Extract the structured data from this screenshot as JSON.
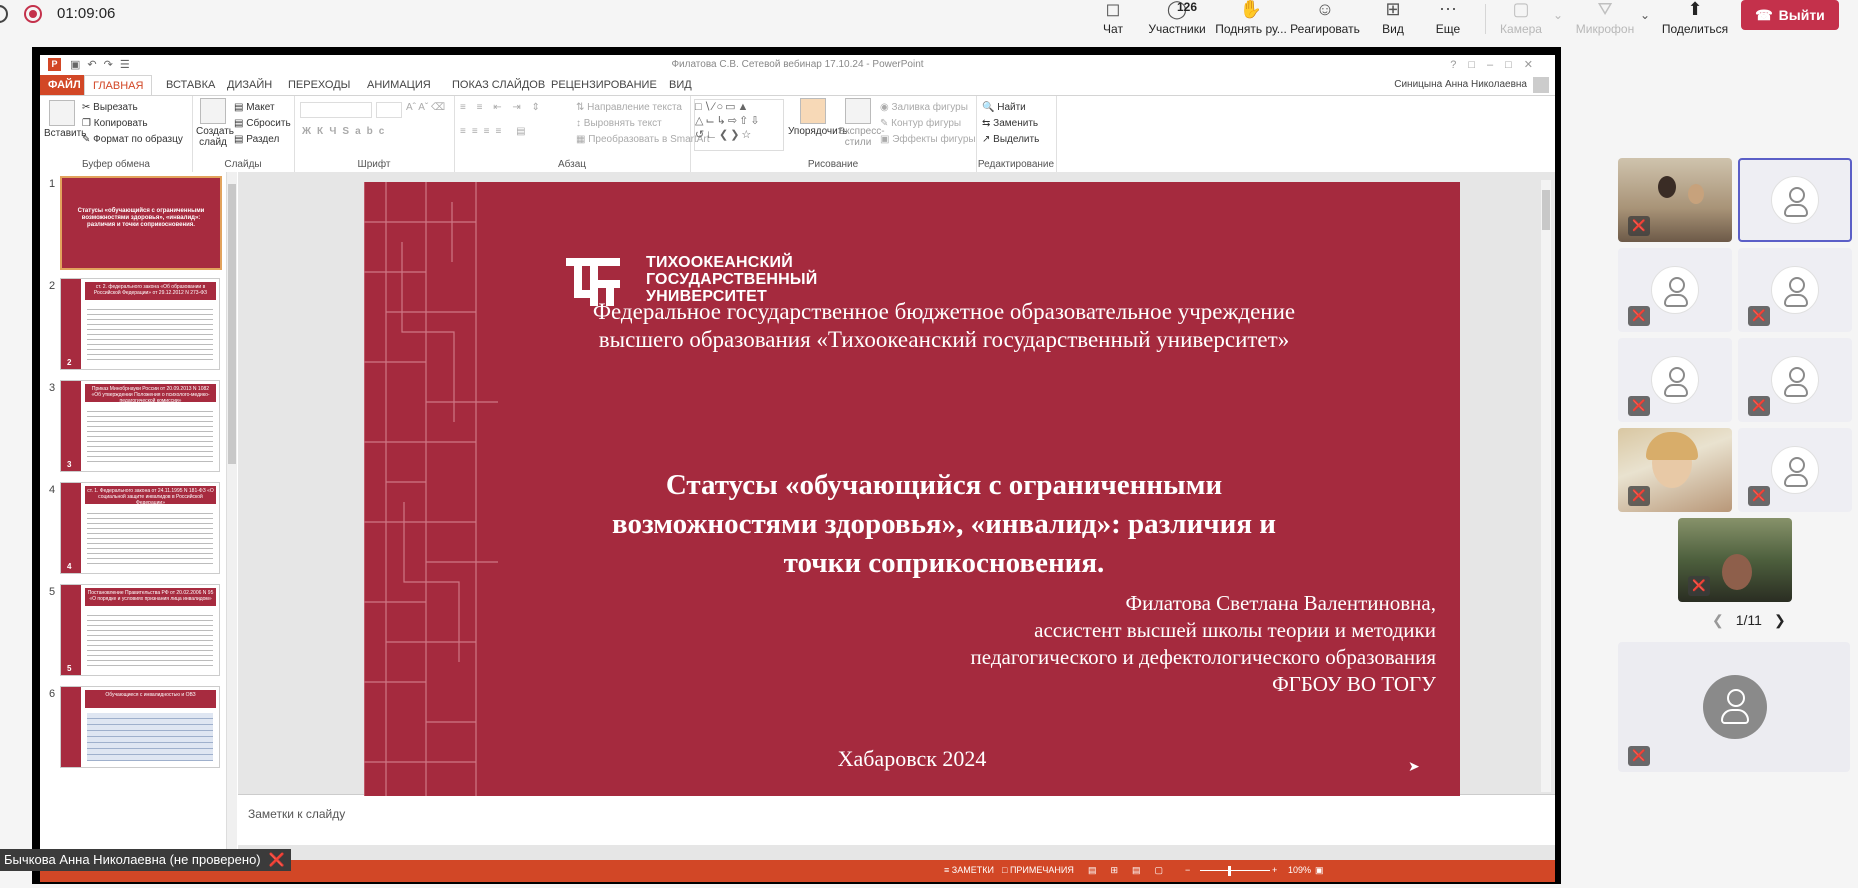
{
  "meeting": {
    "timer": "01:09:06",
    "participants_count": "126",
    "toolbar": {
      "chat": "Чат",
      "participants": "Участники",
      "raise_hand": "Поднять ру...",
      "react": "Реагировать",
      "view": "Вид",
      "more": "Еще",
      "camera": "Камера",
      "microphone": "Микрофон",
      "share": "Поделиться",
      "leave": "Выйти"
    },
    "pager": "1/11",
    "presenter_name": "Бычкова Анна Николаевна (не проверено)",
    "colors": {
      "leave": "#c4314b",
      "selected_tile": "#5b5fc7"
    }
  },
  "ppt": {
    "window_title": "Филатова С.В. Сетевой вебинар 17.10.24 - PowerPoint",
    "user": "Синицына Анна Николаевна",
    "tabs": [
      "ФАЙЛ",
      "ГЛАВНАЯ",
      "ВСТАВКА",
      "ДИЗАЙН",
      "ПЕРЕХОДЫ",
      "АНИМАЦИЯ",
      "ПОКАЗ СЛАЙДОВ",
      "РЕЦЕНЗИРОВАНИЕ",
      "ВИД"
    ],
    "ribbon": {
      "clipboard": {
        "label": "Буфер обмена",
        "paste": "Вставить",
        "cut": "Вырезать",
        "copy": "Копировать",
        "format_painter": "Формат по образцу"
      },
      "slides": {
        "label": "Слайды",
        "new_slide": "Создать слайд",
        "layout": "Макет",
        "reset": "Сбросить",
        "section": "Раздел"
      },
      "font": {
        "label": "Шрифт"
      },
      "paragraph": {
        "label": "Абзац",
        "text_direction": "Направление текста",
        "align_text": "Выровнять текст",
        "smartart": "Преобразовать в SmartArt"
      },
      "drawing": {
        "label": "Рисование",
        "arrange": "Упорядочить",
        "quick_styles": "Экспресс-стили",
        "shape_fill": "Заливка фигуры",
        "shape_outline": "Контур фигуры",
        "shape_effects": "Эффекты фигуры"
      },
      "editing": {
        "label": "Редактирование",
        "find": "Найти",
        "replace": "Заменить",
        "select": "Выделить"
      }
    },
    "notes_placeholder": "Заметки к слайду",
    "status": {
      "notes": "ЗАМЕТКИ",
      "comments": "ПРИМЕЧАНИЯ",
      "zoom": "109%"
    },
    "thumbnails": [
      {
        "num": "1",
        "header": "Статусы «обучающийся с ограниченными возможностями здоровья», «инвалид»: различия и точки соприкосновения."
      },
      {
        "num": "2",
        "header": "ст. 2. федерального закона «Об образовании в Российской Федерации» от 29.12.2012 N 273-ФЗ"
      },
      {
        "num": "3",
        "header": "Приказ Минобрнауки России от 20.09.2013 N 1082 «Об утверждении Положения о психолого-медико-педагогической комиссии»"
      },
      {
        "num": "4",
        "header": "ст. 1. Федерального закона от 24.11.1995 N 181-ФЗ «О социальной защите инвалидов в Российской Федерации»"
      },
      {
        "num": "5",
        "header": "Постановление Правительства РФ от 20.02.2006 N 95 «О порядке и условиях признания лица инвалидом»"
      },
      {
        "num": "6",
        "header": "Обучающиеся с инвалидностью и ОВЗ"
      }
    ],
    "accent": "#d24726"
  },
  "slide": {
    "university": [
      "ТИХООКЕАНСКИЙ",
      "ГОСУДАРСТВЕННЫЙ",
      "УНИВЕРСИТЕТ"
    ],
    "institution": [
      "Федеральное государственное бюджетное образовательное учреждение",
      "высшего образования «Тихоокеанский государственный университет»"
    ],
    "title": [
      "Статусы «обучающийся с ограниченными",
      "возможностями здоровья», «инвалид»: различия и",
      "точки соприкосновения."
    ],
    "author": [
      "Филатова Светлана Валентиновна,",
      "ассистент высшей школы теории и методики",
      "педагогического и дефектологического образования",
      "ФГБОУ ВО ТОГУ"
    ],
    "city_year": "Хабаровск 2024",
    "background": "#a52a3e"
  }
}
